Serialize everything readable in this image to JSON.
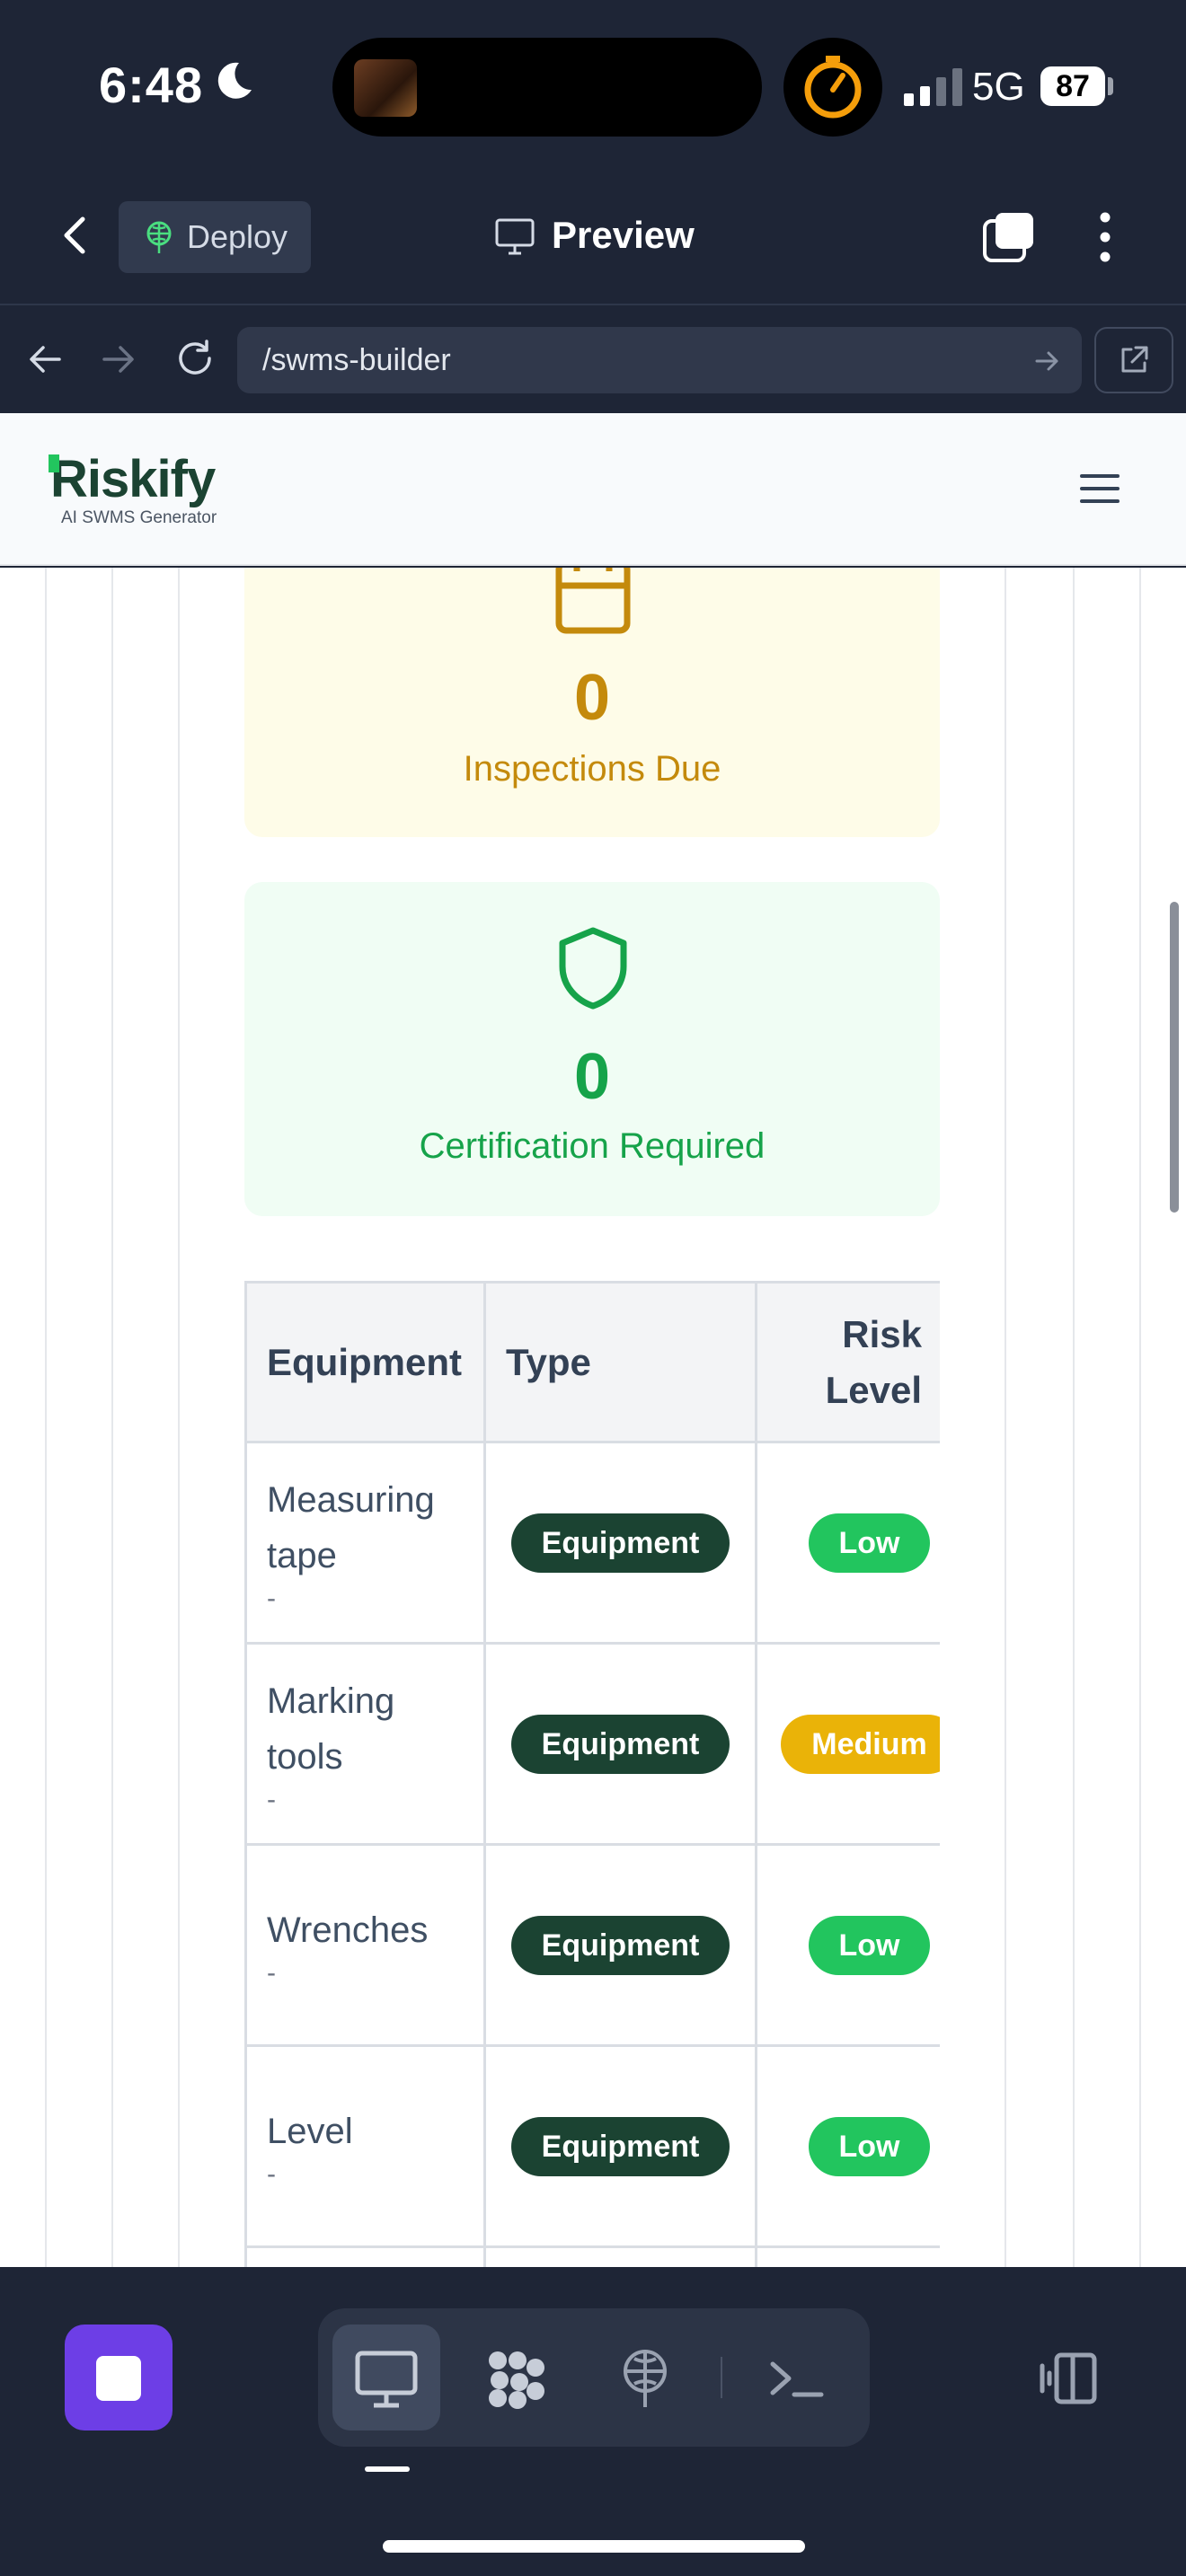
{
  "status_bar": {
    "time": "6:48",
    "network": "5G",
    "battery": "87"
  },
  "toolbar": {
    "deploy_label": "Deploy",
    "preview_label": "Preview"
  },
  "url_bar": {
    "url": "/swms-builder"
  },
  "app": {
    "logo": "Riskify",
    "tagline": "AI SWMS Generator"
  },
  "stats": [
    {
      "value": "0",
      "label": "Inspections Due",
      "color": "#c48a0c",
      "icon": "calendar-icon"
    },
    {
      "value": "0",
      "label": "Certification Required",
      "color": "#16a34a",
      "icon": "shield-icon"
    }
  ],
  "table": {
    "headers": [
      "Equipment",
      "Type",
      "Risk Level"
    ],
    "rows": [
      {
        "name": "Measuring tape",
        "detail": "-",
        "type": "Equipment",
        "risk": "Low"
      },
      {
        "name": "Marking tools",
        "detail": "-",
        "type": "Equipment",
        "risk": "Medium"
      },
      {
        "name": "Wrenches",
        "detail": "-",
        "type": "Equipment",
        "risk": "Low"
      },
      {
        "name": "Level",
        "detail": "-",
        "type": "Equipment",
        "risk": "Low"
      }
    ]
  },
  "colors": {
    "brand": "#1b4332",
    "accent": "#6d3ee6",
    "low": "#22c55e",
    "medium": "#eab308"
  },
  "dock_icons": [
    "desktop-icon",
    "puzzle-icon",
    "deploy-icon",
    "terminal-icon",
    "sidebar-toggle-icon"
  ]
}
